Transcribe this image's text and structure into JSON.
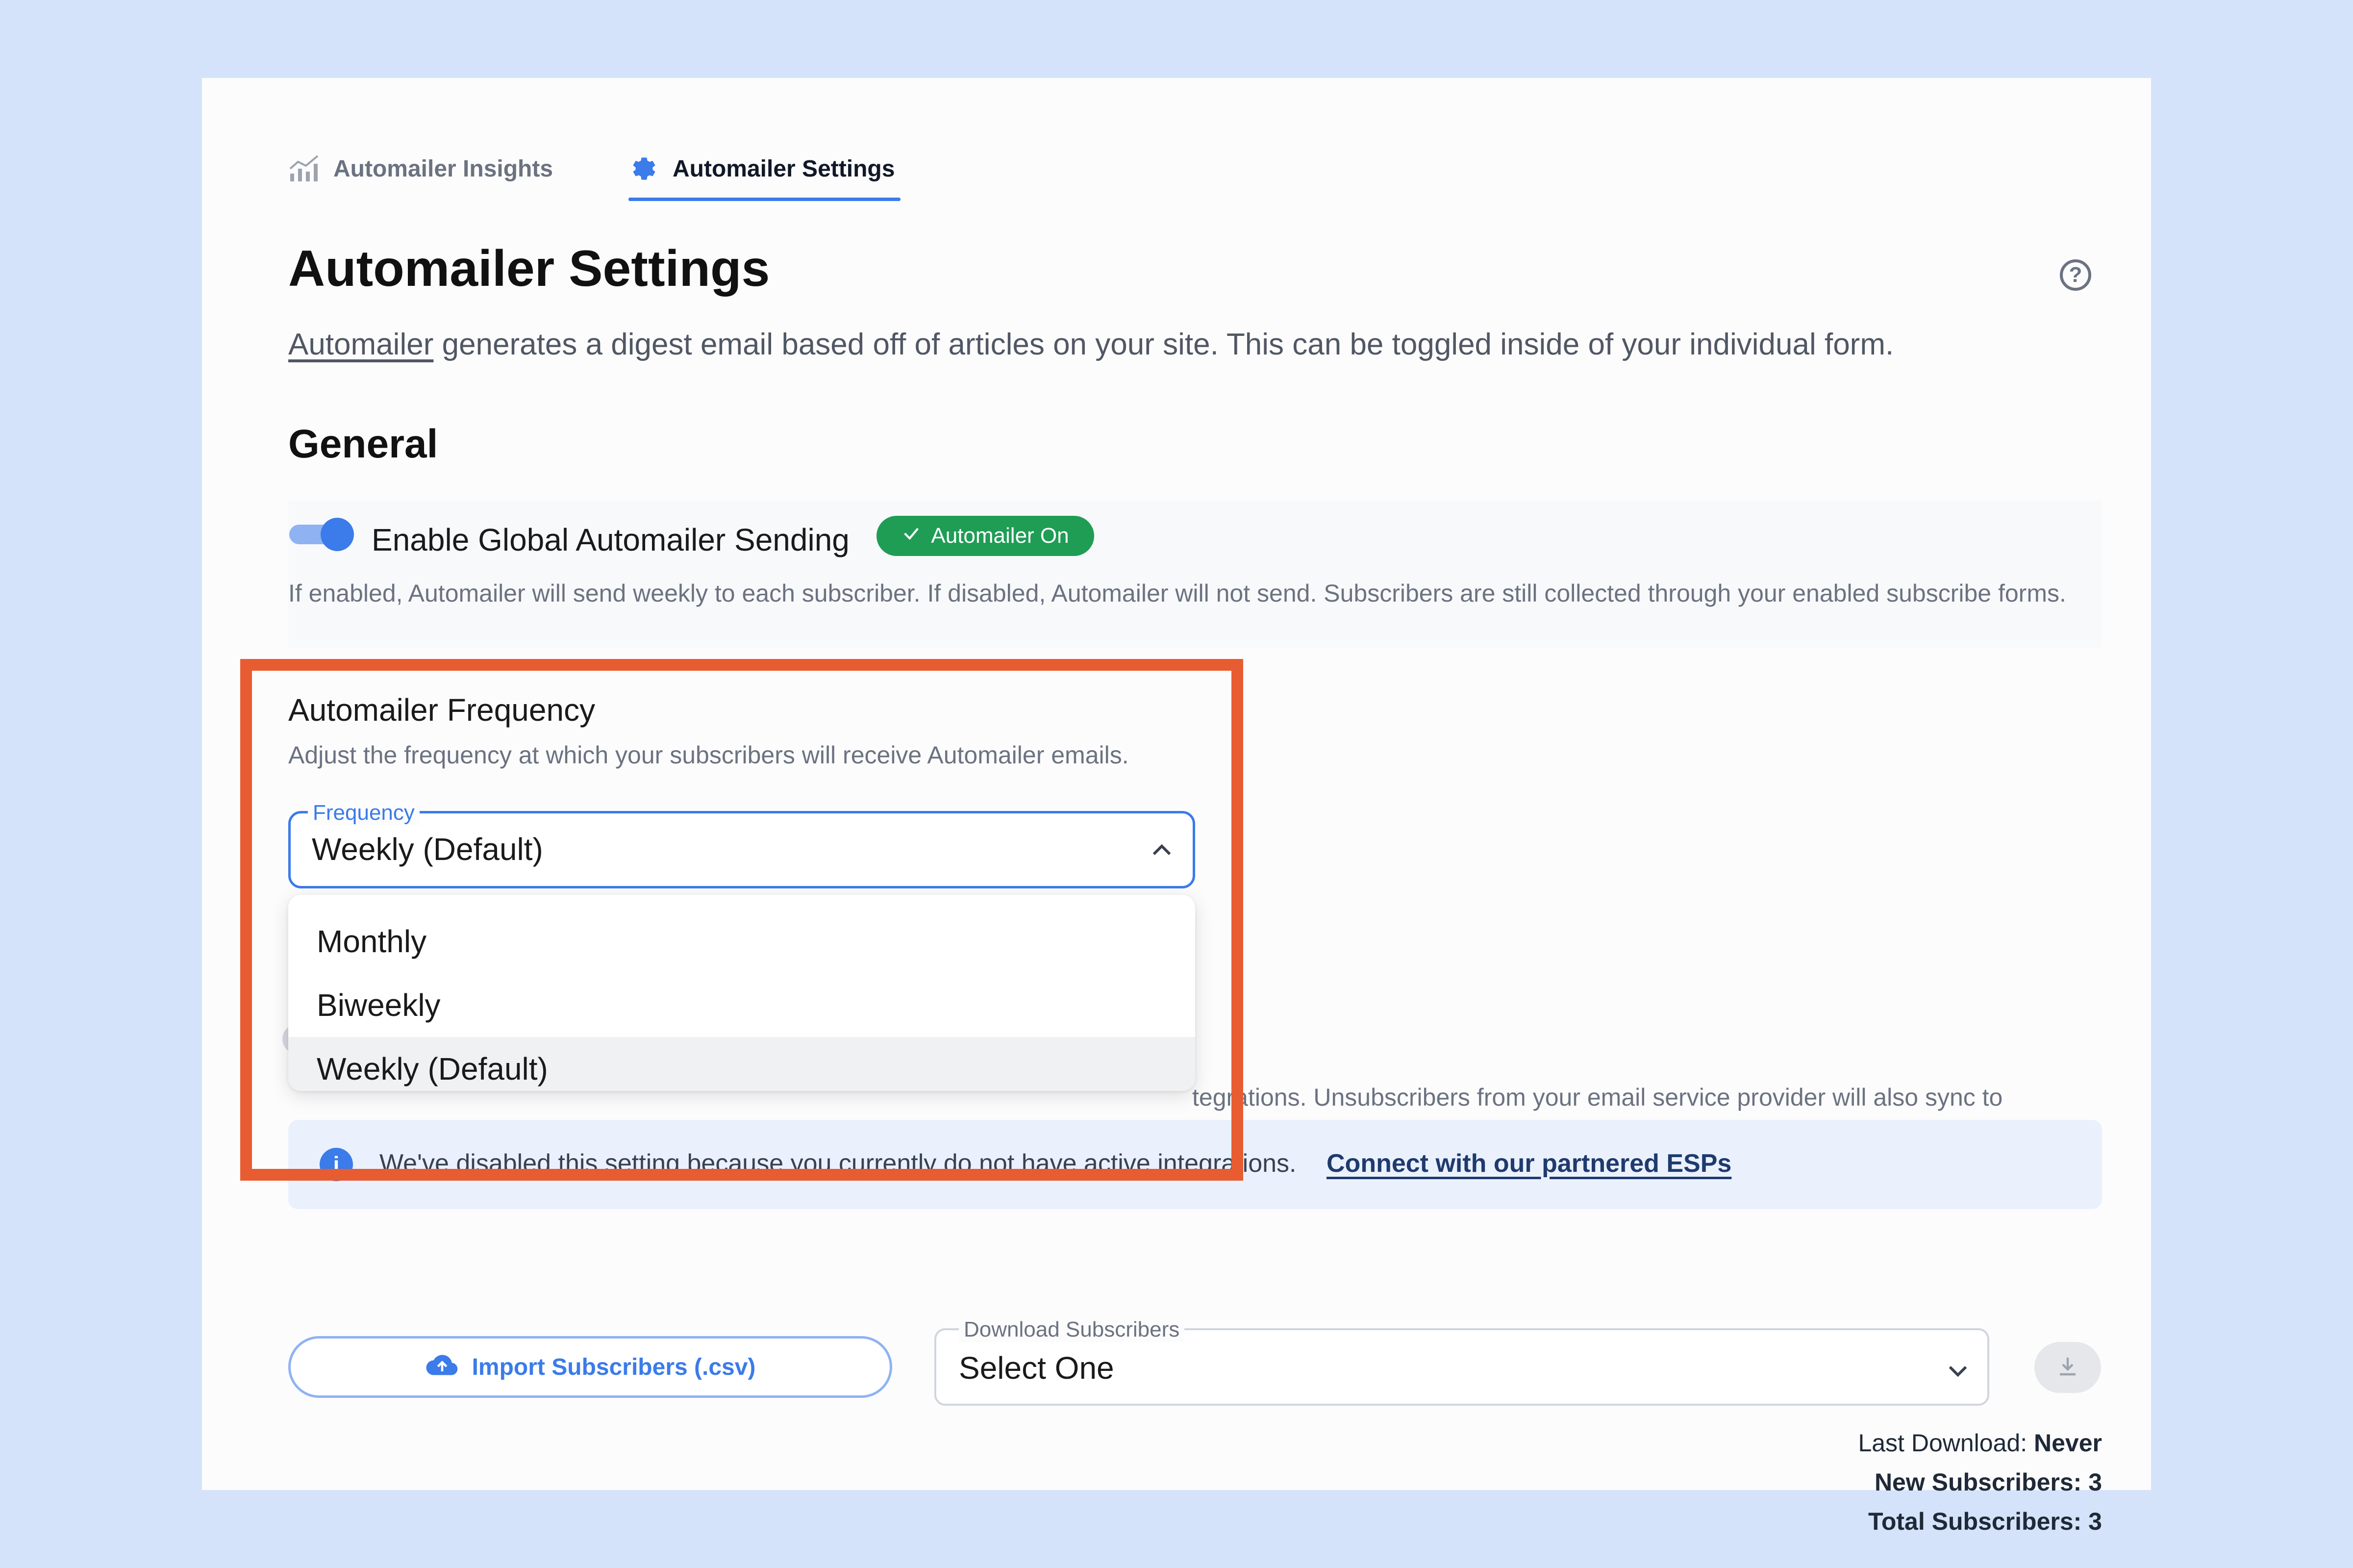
{
  "tabs": {
    "insights_label": "Automailer Insights",
    "settings_label": "Automailer Settings"
  },
  "header": {
    "title": "Automailer Settings",
    "description_link": "Automailer",
    "description_rest": " generates a digest email based off of articles on your site. This can be toggled inside of your individual form."
  },
  "general": {
    "title": "General",
    "enable_label": "Enable Global Automailer Sending",
    "status_badge": "Automailer On",
    "enable_description": "If enabled, Automailer will send weekly to each subscriber. If disabled, Automailer will not send. Subscribers are still collected through your enabled subscribe forms."
  },
  "frequency": {
    "title": "Automailer Frequency",
    "description": "Adjust the frequency at which your subscribers will receive Automailer emails.",
    "field_label": "Frequency",
    "value": "Weekly (Default)",
    "options": [
      "Monthly",
      "Biweekly",
      "Weekly (Default)"
    ]
  },
  "sync": {
    "partial_text": "tegrations. Unsubscribers from your email service provider will also sync to"
  },
  "info": {
    "text": "We've disabled this setting because you currently do not have active integrations.",
    "link": "Connect with our partnered ESPs"
  },
  "subscribers": {
    "import_label": "Import Subscribers (.csv)",
    "download_label": "Download Subscribers",
    "download_value": "Select One",
    "last_download_label": "Last Download:",
    "last_download_value": "Never",
    "new_subscribers": "New Subscribers: 3",
    "total_subscribers": "Total Subscribers: 3"
  },
  "colors": {
    "accent": "#3b7bea",
    "success": "#1f9d55",
    "highlight": "#e85c31",
    "background": "#d4e3fa"
  }
}
